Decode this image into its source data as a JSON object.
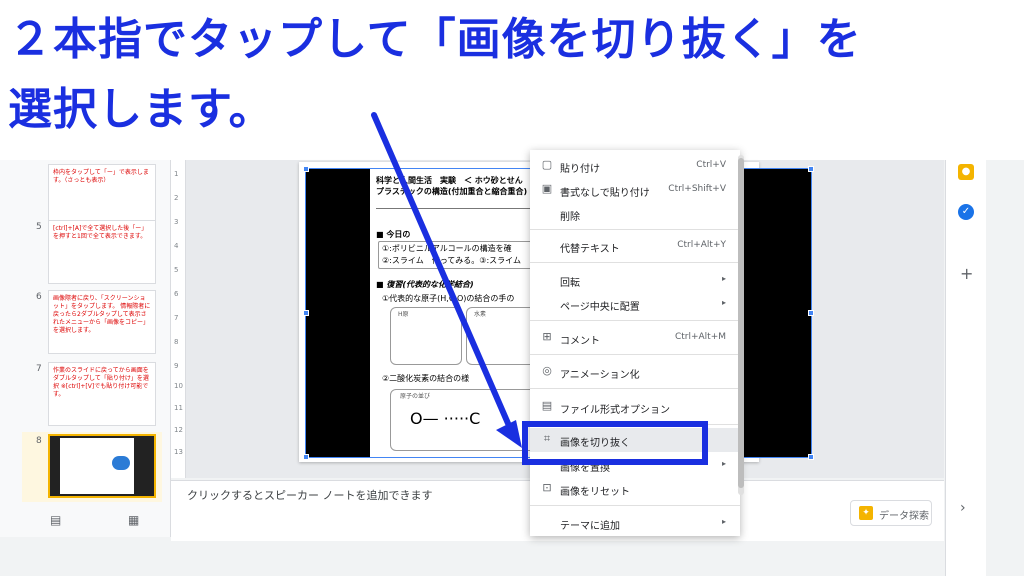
{
  "instruction": {
    "line1": "２本指でタップして「画像を切り抜く」を",
    "line2": "選択します。"
  },
  "thumbnails": [
    {
      "number": "",
      "text": "枠内をタップして「ー」で表示します。（さっとも表示）"
    },
    {
      "number": "5",
      "text": "[ctrl]+[A]で全て選択した後「ー」を押すと1回で全て表示できます。"
    },
    {
      "number": "6",
      "text": "画像際者に戻り、「スクリーンショット」をタップします。 情報際者に戻ったら2ダブルタップして表示されたメニューから「画像をコピー」を選択します。"
    },
    {
      "number": "7",
      "text": "作業のスライドに戻ってから画面をダブルタップして「貼り付け」を選択 ※[ctrl]+[V]でも貼り付け可能です。"
    },
    {
      "number": "8",
      "text": ""
    }
  ],
  "worksheet": {
    "title": "科学と人間生活　実験　＜ ホウ砂とせん",
    "subtitle": "プラスチックの構造(付加重合と縮合重合)",
    "paren": "（　　）",
    "goal_heading": "■ 今日の",
    "goal_1": "①:ポリビニルアルコールの構造を確",
    "goal_2": "②:スライム　作ってみる。③:スライム",
    "review_heading": "■ 復習(代表的な化学結合)",
    "review_1": "①代表的な原子(H,C,O)の結合の手の",
    "box_label_1": "H原",
    "box_label_2": "水素",
    "review_2": "②二酸化炭素の結合の様",
    "box_label_3": "原子の並び",
    "formula": "O— ·····C"
  },
  "notes": {
    "placeholder": "クリックするとスピーカー ノートを追加できます"
  },
  "explore": {
    "label": "データ探索"
  },
  "context_menu": {
    "items": [
      {
        "icon": "paste-icon",
        "glyph": "▢",
        "label": "貼り付け",
        "shortcut": "Ctrl+V"
      },
      {
        "icon": "paste-plain-icon",
        "glyph": "▣",
        "label": "書式なしで貼り付け",
        "shortcut": "Ctrl+Shift+V"
      },
      {
        "icon": "",
        "glyph": "",
        "label": "削除",
        "shortcut": ""
      },
      {
        "icon": "",
        "glyph": "",
        "label": "代替テキスト",
        "shortcut": "Ctrl+Alt+Y"
      },
      {
        "icon": "",
        "glyph": "",
        "label": "回転",
        "shortcut": "",
        "arrow": "▸"
      },
      {
        "icon": "",
        "glyph": "",
        "label": "ページ中央に配置",
        "shortcut": "",
        "arrow": "▸"
      },
      {
        "icon": "comment-icon",
        "glyph": "⊞",
        "label": "コメント",
        "shortcut": "Ctrl+Alt+M"
      },
      {
        "icon": "animation-icon",
        "glyph": "◎",
        "label": "アニメーション化",
        "shortcut": ""
      },
      {
        "icon": "format-options-icon",
        "glyph": "▤",
        "label": "ファイル形式オプション",
        "shortcut": ""
      },
      {
        "icon": "crop-icon",
        "glyph": "⌗",
        "label": "画像を切り抜く",
        "shortcut": ""
      },
      {
        "icon": "",
        "glyph": "",
        "label": "画像を置換",
        "shortcut": "",
        "arrow": "▸"
      },
      {
        "icon": "reset-image-icon",
        "glyph": "⊡",
        "label": "画像をリセット",
        "shortcut": ""
      },
      {
        "icon": "",
        "glyph": "",
        "label": "テーマに追加",
        "shortcut": "",
        "arrow": "▸"
      }
    ]
  },
  "colors": {
    "annotation_blue": "#1a2fe0",
    "selection_blue": "#4285f4",
    "thumb_selected": "#f4b400"
  }
}
